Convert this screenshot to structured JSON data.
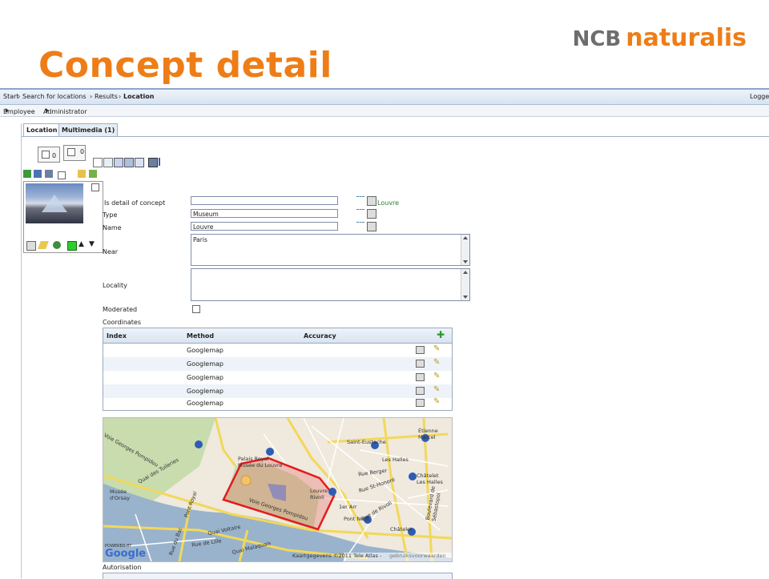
{
  "slide": {
    "title": "Concept detail"
  },
  "logo": {
    "ncb": "NCB",
    "naturalis": "naturalis"
  },
  "breadcrumb": {
    "items": [
      "Start",
      "Search for locations",
      "Results",
      "Location"
    ],
    "separator": "›",
    "right_text": "Logge"
  },
  "menu": {
    "items": [
      "Employee",
      "Administrator"
    ]
  },
  "tabs": [
    {
      "label": "Location"
    },
    {
      "label": "Multimedia (1)"
    }
  ],
  "counters": {
    "first": "0",
    "second": "0"
  },
  "form": {
    "is_detail_label": "Is detail of concept",
    "is_detail_value": "",
    "is_detail_link": "Louvre",
    "type_label": "Type",
    "type_value": "Museum",
    "name_label": "Name",
    "name_value": "Louvre",
    "near_label": "Near",
    "near_value": "Paris",
    "locality_label": "Locality",
    "locality_value": "",
    "moderated_label": "Moderated",
    "coordinates_label": "Coordinates",
    "autorisation_label": "Autorisation"
  },
  "coordinates_table": {
    "headers": [
      "Index",
      "Method",
      "Accuracy"
    ],
    "rows": [
      {
        "index": "",
        "method": "Googlemap",
        "accuracy": ""
      },
      {
        "index": "",
        "method": "Googlemap",
        "accuracy": ""
      },
      {
        "index": "",
        "method": "Googlemap",
        "accuracy": ""
      },
      {
        "index": "",
        "method": "Googlemap",
        "accuracy": ""
      },
      {
        "index": "",
        "method": "Googlemap",
        "accuracy": ""
      }
    ]
  },
  "map": {
    "labels": {
      "palais": "Palais Royal -\nMusée du Louvre",
      "eustache": "Saint-Eustache",
      "halles": "Les Halles",
      "etienne": "Étienne\nMarcel",
      "chatelet1": "Châtelet\nLes Halles",
      "louvre_rivoli": "Louvre -\nRivoli",
      "arr": "1er Arr",
      "pontneuf": "Pont Neuf",
      "chatelet2": "Châtelet",
      "orsay": "Musée\nd'Orsay",
      "tuileries": "Quai des Tuileries",
      "pompidou1": "Voie Georges Pompidou",
      "pompidou2": "Voie Georges Pompidou",
      "voltaire": "Quai Voltaire",
      "rivoli": "Rue de Rivoli",
      "berger": "Rue Berger",
      "sthonore": "Rue St-Honoré",
      "sebastopol": "Boulevard de Sébastopol",
      "pontroyal": "Pont Royal",
      "malaquais": "Quai Malaquais",
      "bac": "Rue du Bac",
      "lille": "Rue de Lille",
      "powered": "POWERED BY",
      "google": "Google",
      "copyright": "Kaartgegevens ©2011 Tele Atlas -",
      "terms": "gebruiksvoorwaarden"
    }
  },
  "colors": {
    "title_orange": "#ee7d17",
    "highlight": "#e21b1b",
    "link_green": "#2b7d2b"
  }
}
